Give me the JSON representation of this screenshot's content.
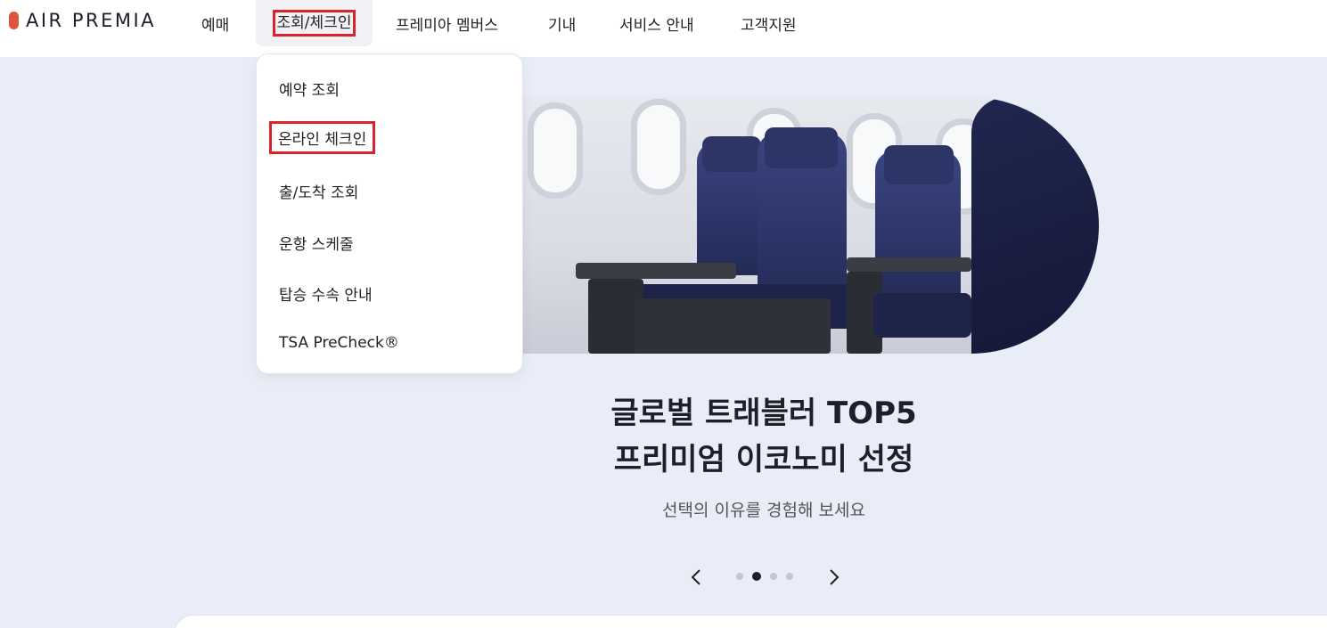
{
  "brand": {
    "name": "AIR PREMIA",
    "color": "#e0533d"
  },
  "nav": {
    "items": [
      {
        "label": "예매"
      },
      {
        "label": "조회/체크인"
      },
      {
        "label": "프레미아 멤버스"
      },
      {
        "label": "기내"
      },
      {
        "label": "서비스 안내"
      },
      {
        "label": "고객지원"
      }
    ],
    "active_index": 1
  },
  "dropdown": {
    "items": [
      {
        "label": "예약 조회"
      },
      {
        "label": "온라인 체크인"
      },
      {
        "label": "출/도착 조회"
      },
      {
        "label": "운항 스케줄"
      },
      {
        "label": "탑승 수속 안내"
      },
      {
        "label": "TSA PreCheck®"
      }
    ],
    "highlighted_index": 1
  },
  "hero": {
    "headline_line1": "글로벌 트래블러 TOP5",
    "headline_line2": "프리미엄 이코노미 선정",
    "subtitle": "선택의 이유를 경험해 보세요"
  },
  "carousel": {
    "prev_icon": "chevron-left-icon",
    "next_icon": "chevron-right-icon",
    "slide_count": 4,
    "active_slide": 2
  },
  "colors": {
    "highlight_border": "#d8232a",
    "page_background": "#e9edf7",
    "seat_navy": "#2c3566"
  }
}
